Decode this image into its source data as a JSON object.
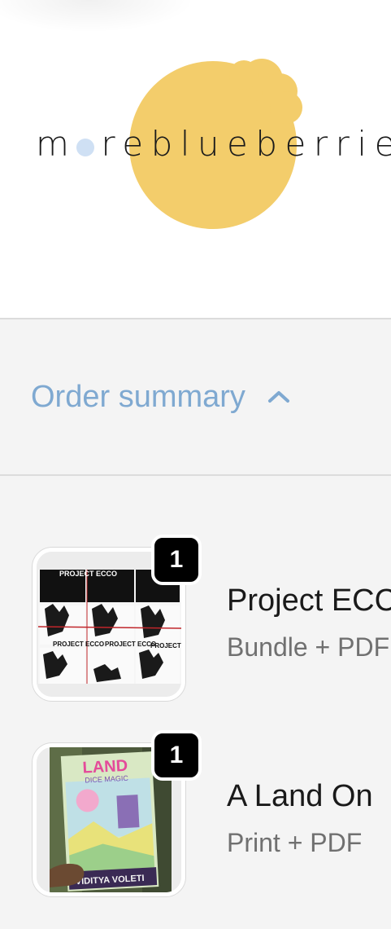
{
  "brand": {
    "logo_text": "moreblueberries",
    "logo_prefix": "m",
    "logo_suffix": "reblueberries",
    "accent_colors": {
      "blob": "#f3cd6b",
      "dot": "#cfe0f4",
      "link": "#7fa9d1"
    }
  },
  "order_summary": {
    "toggle_label": "Order summary",
    "toggle_icon": "chevron-up-icon",
    "expanded": true
  },
  "line_items": [
    {
      "quantity": "1",
      "title": "Project ECCO",
      "variant": "Bundle + PDF",
      "image_icon": "product-image"
    },
    {
      "quantity": "1",
      "title": "A Land On",
      "variant": "Print + PDF",
      "image_icon": "product-image"
    }
  ],
  "thumb_texts": {
    "ecco_label_top": "PROJECT ECCO",
    "ecco_label": "PROJECT ECCO",
    "land_cover_title": "LAND",
    "land_cover_sub": "DICE MAGIC",
    "land_author": "VIDITYA VOLETI"
  }
}
